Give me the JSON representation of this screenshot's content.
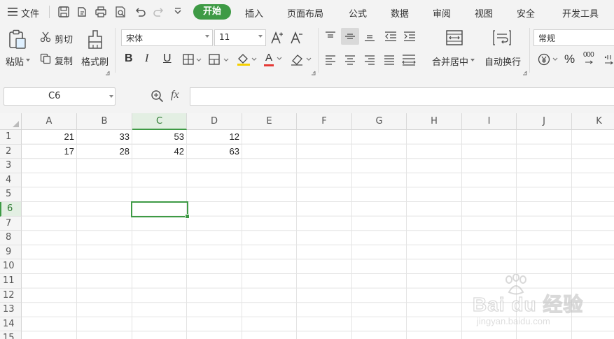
{
  "menu": {
    "file_label": "文件",
    "tabs": [
      "开始",
      "插入",
      "页面布局",
      "公式",
      "数据",
      "审阅",
      "视图",
      "安全",
      "开发工具"
    ]
  },
  "ribbon": {
    "paste": "粘贴",
    "cut": "剪切",
    "copy": "复制",
    "format_painter": "格式刷",
    "font_name": "宋体",
    "font_size": "11",
    "bold": "B",
    "italic": "I",
    "underline": "U",
    "font_color_glyph": "A",
    "merge_center": "合并居中",
    "wrap_text": "自动换行",
    "number_format": "常规",
    "percent": "%",
    "thousands": "000"
  },
  "formula_bar": {
    "name_box": "C6",
    "fx": "fx",
    "value": ""
  },
  "sheet": {
    "columns": [
      "A",
      "B",
      "C",
      "D",
      "E",
      "F",
      "G",
      "H",
      "I",
      "J",
      "K"
    ],
    "selected_column": "C",
    "rows": [
      "1",
      "2",
      "3",
      "4",
      "5",
      "6",
      "7",
      "8",
      "9",
      "10",
      "11",
      "12",
      "13",
      "14",
      "15"
    ],
    "selected_row": "6",
    "cells": [
      [
        "21",
        "33",
        "53",
        "12"
      ],
      [
        "17",
        "28",
        "42",
        "63"
      ]
    ]
  },
  "watermark": {
    "brand": "Bai du 经验",
    "url": "jingyan.baidu.com"
  },
  "colors": {
    "accent": "#3e9a45",
    "font_color_bar": "#e53935",
    "fill_color_bar": "#f5d000"
  }
}
